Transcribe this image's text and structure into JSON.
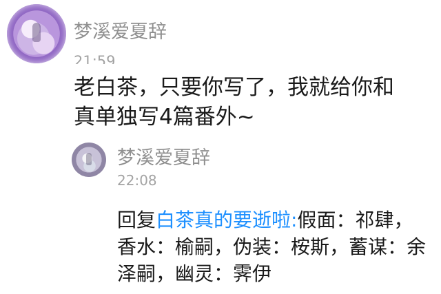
{
  "thread": {
    "main_post": {
      "user_name": "梦溪爱夏辞",
      "time": "21:59",
      "message": "老白茶，只要你写了，我就给你和\n真单独写4篇番外~"
    },
    "reply": {
      "user_name": "梦溪爱夏辞",
      "time": "22:08",
      "prefix": "回复",
      "mention": "白茶真的要逝啦:",
      "text_line_1": "假面：祁肆，",
      "text_line_2": "香水：榆嗣，伪装：桉斯，蓄谋：余",
      "text_line_3": "泽嗣，幽灵：霁伊"
    }
  },
  "colors": {
    "background": "#ffffff",
    "primary_text": "#1a1a1a",
    "secondary_text": "#909090",
    "mention_link": "#1e90ff"
  },
  "icons": {
    "main_avatar": "avatar",
    "reply_avatar": "avatar"
  }
}
